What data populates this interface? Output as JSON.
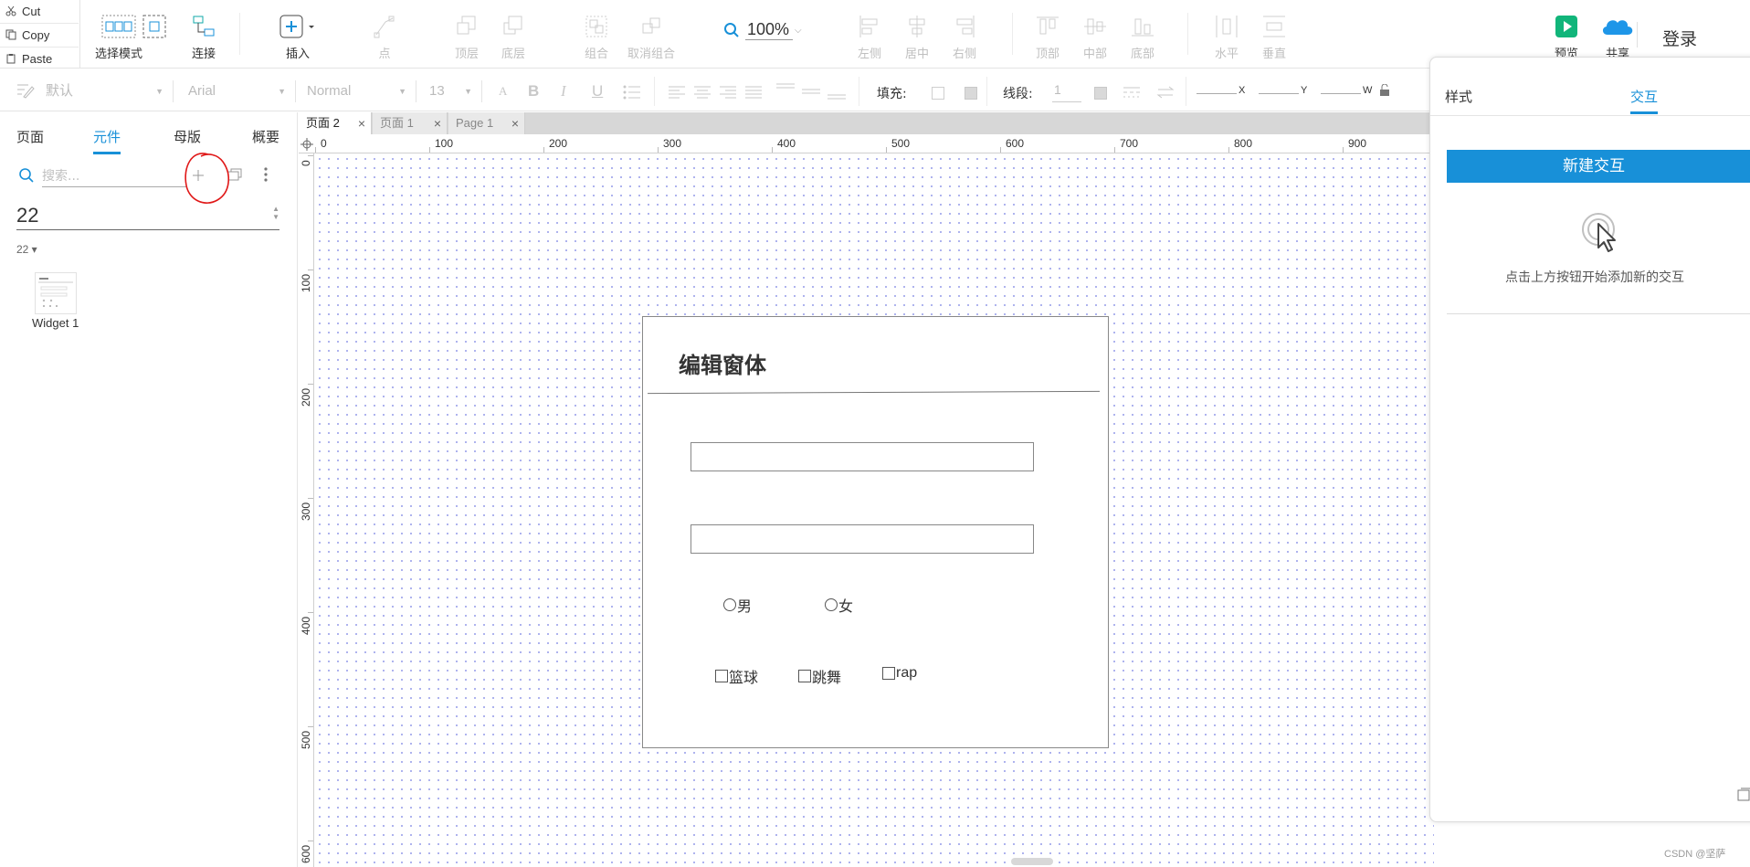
{
  "clipboard": {
    "cut": "Cut",
    "copy": "Copy",
    "paste": "Paste"
  },
  "toolbar": {
    "select_mode": "选择模式",
    "connect": "连接",
    "insert": "插入",
    "point": "点",
    "bring_top": "顶层",
    "send_bottom": "底层",
    "group": "组合",
    "ungroup": "取消组合",
    "zoom": "100%",
    "align_left": "左侧",
    "align_center": "居中",
    "align_right": "右侧",
    "align_top": "顶部",
    "align_middle": "中部",
    "align_bottom": "底部",
    "distribute_h": "水平",
    "distribute_v": "垂直",
    "preview": "预览",
    "share": "共享",
    "login": "登录"
  },
  "format": {
    "style": "默认",
    "font": "Arial",
    "weight": "Normal",
    "size": "13",
    "fill_label": "填充:",
    "stroke_label": "线段:",
    "stroke_value": "1",
    "x_label": "X",
    "y_label": "Y",
    "w_label": "W"
  },
  "left_panel": {
    "tabs": [
      "页面",
      "元件",
      "母版",
      "概要"
    ],
    "active_tab": 1,
    "search_placeholder": "搜索...",
    "library": "22",
    "group": "22 ▾",
    "widget_label": "Widget 1"
  },
  "page_tabs": [
    "页面 2",
    "页面 1",
    "Page 1"
  ],
  "ruler": {
    "h": [
      "0",
      "100",
      "200",
      "300",
      "400",
      "500",
      "600",
      "700",
      "800",
      "900"
    ],
    "v": [
      "0",
      "100",
      "200",
      "300",
      "400",
      "500",
      "600"
    ]
  },
  "form": {
    "title": "编辑窗体",
    "radios": [
      "男",
      "女"
    ],
    "checkboxes": [
      "篮球",
      "跳舞",
      "rap"
    ]
  },
  "right_panel": {
    "tab_style": "样式",
    "tab_interaction": "交互",
    "new_interaction": "新建交互",
    "hint": "点击上方按钮开始添加新的交互"
  },
  "watermark": "CSDN @坚萨",
  "colors": {
    "accent": "#1890d8",
    "grid_dot": "#9aa0ea",
    "preview_green": "#11b57a",
    "share_blue": "#1e96e8"
  }
}
